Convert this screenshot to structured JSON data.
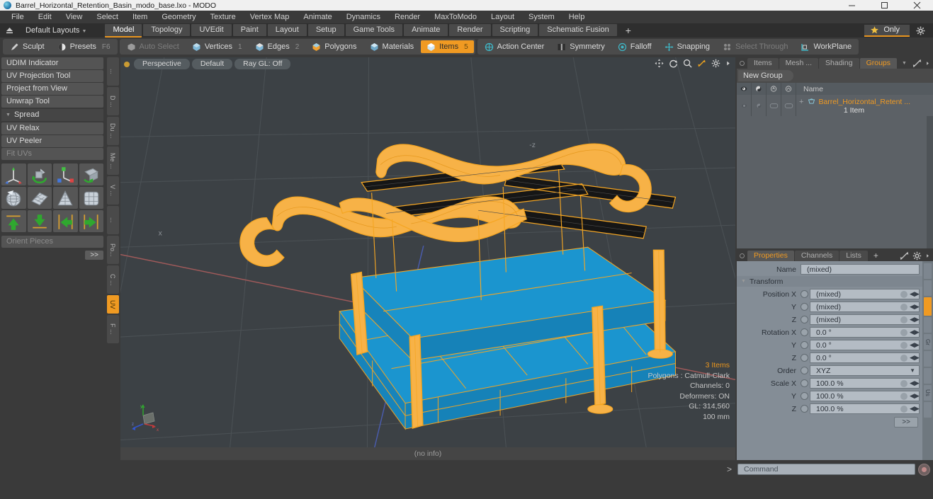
{
  "window": {
    "title": "Barrel_Horizontal_Retention_Basin_modo_base.lxo - MODO",
    "app_icon": "modo-sphere-icon",
    "minimize": "minimize-icon",
    "maximize": "maximize-icon",
    "close": "close-icon"
  },
  "menubar": {
    "items": [
      "File",
      "Edit",
      "View",
      "Select",
      "Item",
      "Geometry",
      "Texture",
      "Vertex Map",
      "Animate",
      "Dynamics",
      "Render",
      "MaxToModo",
      "Layout",
      "System",
      "Help"
    ]
  },
  "layoutbar": {
    "upload_icon": "eject-icon",
    "layout_label": "Default Layouts",
    "layout_caret": "chevron-down-icon",
    "tabs": [
      {
        "label": "Model",
        "active": true
      },
      {
        "label": "Topology",
        "active": false
      },
      {
        "label": "UVEdit",
        "active": false
      },
      {
        "label": "Paint",
        "active": false
      },
      {
        "label": "Layout",
        "active": false
      },
      {
        "label": "Setup",
        "active": false
      },
      {
        "label": "Game Tools",
        "active": false
      },
      {
        "label": "Animate",
        "active": false
      },
      {
        "label": "Render",
        "active": false
      },
      {
        "label": "Scripting",
        "active": false
      },
      {
        "label": "Schematic Fusion",
        "active": false
      }
    ],
    "add_tab": "+",
    "only_label": "Only",
    "star_icon": "star-icon",
    "gear_icon": "gear-icon"
  },
  "modebar": {
    "left_group": [
      {
        "label": "Sculpt",
        "icon": "pencil-icon",
        "state": "normal",
        "shortcut": ""
      },
      {
        "label": "Presets",
        "icon": "sphere-icon",
        "state": "normal",
        "shortcut": "F6"
      }
    ],
    "select_group": [
      {
        "label": "Auto Select",
        "icon": "cube-icon",
        "state": "dim",
        "num": ""
      },
      {
        "label": "Vertices",
        "icon": "vertex-icon",
        "state": "normal",
        "num": "1"
      },
      {
        "label": "Edges",
        "icon": "edge-icon",
        "state": "normal",
        "num": "2"
      },
      {
        "label": "Polygons",
        "icon": "polygon-icon",
        "state": "normal",
        "num": ""
      },
      {
        "label": "Materials",
        "icon": "material-icon",
        "state": "normal",
        "num": ""
      },
      {
        "label": "Items",
        "icon": "items-icon",
        "state": "selected",
        "num": "5"
      }
    ],
    "right_group": [
      {
        "label": "Action Center",
        "icon": "action-center-icon",
        "state": "normal"
      },
      {
        "label": "Symmetry",
        "icon": "symmetry-icon",
        "state": "normal"
      },
      {
        "label": "Falloff",
        "icon": "falloff-icon",
        "state": "normal"
      },
      {
        "label": "Snapping",
        "icon": "snapping-icon",
        "state": "normal"
      },
      {
        "label": "Select Through",
        "icon": "select-through-icon",
        "state": "dim"
      },
      {
        "label": "WorkPlane",
        "icon": "workplane-icon",
        "state": "normal"
      }
    ]
  },
  "left_toolbox": {
    "rows": [
      {
        "label": "UDIM Indicator",
        "state": "normal"
      },
      {
        "label": "UV Projection Tool",
        "state": "normal"
      },
      {
        "label": "Project from View",
        "state": "normal"
      },
      {
        "label": "Unwrap Tool",
        "state": "normal"
      }
    ],
    "spread_label": "Spread",
    "rows2": [
      {
        "label": "UV Relax",
        "state": "normal"
      },
      {
        "label": "UV Peeler",
        "state": "normal"
      },
      {
        "label": "Fit UVs",
        "state": "dim"
      }
    ],
    "icon_buttons": [
      "uv-move-icon",
      "uv-rotate-icon",
      "uv-scale-icon",
      "uv-flip-icon",
      "uv-sphere-unwrap-icon",
      "uv-plane-grid-icon",
      "uv-cone-unwrap-icon",
      "uv-box-unwrap-icon",
      "align-up-icon",
      "align-down-icon",
      "align-left-icon",
      "align-right-icon"
    ],
    "orient_label": "Orient Pieces",
    "more_label": ">>",
    "vtabs": [
      {
        "label": "...",
        "active": false
      },
      {
        "label": "D ...",
        "active": false
      },
      {
        "label": "Du ...",
        "active": false
      },
      {
        "label": "Me ...",
        "active": false
      },
      {
        "label": "V ...",
        "active": false
      },
      {
        "label": "...",
        "active": false
      },
      {
        "label": "Po...",
        "active": false
      },
      {
        "label": "C ...",
        "active": false
      },
      {
        "label": "UV",
        "active": true
      },
      {
        "label": "F ...",
        "active": false
      }
    ]
  },
  "viewport": {
    "view_mode": "Perspective",
    "shading": "Default",
    "raygl": "Ray GL: Off",
    "nav_icons": [
      "pan-icon",
      "rotate-icon",
      "zoom-icon",
      "fit-icon",
      "viewport-gear-icon",
      "viewport-arrow-icon"
    ],
    "stats": {
      "items": "3 Items",
      "polygons": "Polygons : Catmull-Clark",
      "channels": "Channels: 0",
      "deformers": "Deformers: ON",
      "gl": "GL: 314,560",
      "scale": "100 mm"
    },
    "axis_labels": {
      "x": "x",
      "y": "y",
      "z": "z"
    },
    "axis_marker_top": "-z",
    "axis_marker_left": "x",
    "status": "(no info)",
    "colors": {
      "background": "#3c4145",
      "selection": "#f5a623",
      "surface": "#1f9fd8",
      "grid": "#4a5054",
      "x_axis": "#a85b5b",
      "z_axis": "#4a5fa8"
    }
  },
  "groups_panel": {
    "tabs": [
      {
        "label": "Items",
        "active": false
      },
      {
        "label": "Mesh ...",
        "active": false
      },
      {
        "label": "Shading",
        "active": false
      },
      {
        "label": "Groups",
        "active": true
      }
    ],
    "tab_caret": "chevron-down-icon",
    "expand_icon": "expand-icon",
    "arrow_icon": "chevron-right-icon",
    "new_group_button": "New Group",
    "column_icons": [
      "visibility-icon",
      "render-icon",
      "lock-icon",
      "select-lock-icon"
    ],
    "column_name": "Name",
    "row": {
      "item_icon": "group-icon",
      "name": "Barrel_Horizontal_Retent ...",
      "sub": "1 Item",
      "expand": "+"
    }
  },
  "properties_panel": {
    "tabs": [
      {
        "label": "Properties",
        "active": true
      },
      {
        "label": "Channels",
        "active": false
      },
      {
        "label": "Lists",
        "active": false
      }
    ],
    "add_tab": "+",
    "expand_icon": "expand-icon",
    "gear_icon": "gear-icon",
    "arrow_icon": "chevron-right-icon",
    "name_label": "Name",
    "name_value": "(mixed)",
    "transform_label": "Transform",
    "fields": [
      {
        "label": "Position X",
        "value": "(mixed)",
        "type": "spin"
      },
      {
        "label": "Y",
        "value": "(mixed)",
        "type": "spin"
      },
      {
        "label": "Z",
        "value": "(mixed)",
        "type": "spin"
      },
      {
        "label": "Rotation X",
        "value": "0.0 °",
        "type": "spin"
      },
      {
        "label": "Y",
        "value": "0.0 °",
        "type": "spin"
      },
      {
        "label": "Z",
        "value": "0.0 °",
        "type": "spin"
      },
      {
        "label": "Order",
        "value": "XYZ",
        "type": "dropdown"
      },
      {
        "label": "Scale X",
        "value": "100.0 %",
        "type": "spin"
      },
      {
        "label": "Y",
        "value": "100.0 %",
        "type": "spin"
      },
      {
        "label": "Z",
        "value": "100.0 %",
        "type": "spin"
      }
    ],
    "more_label": ">>",
    "vtabs": [
      {
        "label": "",
        "active": false
      },
      {
        "label": "",
        "active": false
      },
      {
        "label": "",
        "active": true
      },
      {
        "label": "",
        "active": false
      },
      {
        "label": "Gr",
        "active": false
      },
      {
        "label": "",
        "active": false
      },
      {
        "label": "",
        "active": false
      },
      {
        "label": "Us",
        "active": false
      },
      {
        "label": "",
        "active": false
      }
    ]
  },
  "command_bar": {
    "prompt": ">",
    "placeholder": "Command",
    "record_icon": "record-icon"
  }
}
